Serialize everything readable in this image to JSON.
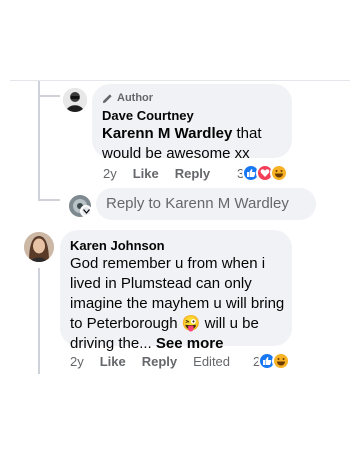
{
  "comments": [
    {
      "is_author": true,
      "author_badge": "Author",
      "name": "Dave Courtney",
      "mention": "Karenn M Wardley",
      "text_after_mention": " that would be awesome xx",
      "time": "2y",
      "like_label": "Like",
      "reply_label": "Reply",
      "reaction_count": "3",
      "reactions": [
        "like",
        "love",
        "haha"
      ]
    },
    {
      "name": "Karen Johnson",
      "text": "God remember u from when i lived in Plumstead can only imagine the mayhem u will bring to Peterborough",
      "emoji": "😜",
      "text_after_emoji": " will u be driving the... ",
      "see_more": "See more",
      "time": "2y",
      "like_label": "Like",
      "reply_label": "Reply",
      "edited_label": "Edited",
      "reaction_count": "2",
      "reactions": [
        "like",
        "haha"
      ]
    }
  ],
  "reply_input": {
    "placeholder": "Reply to Karenn M Wardley"
  },
  "colors": {
    "like": "#1877f2",
    "love": "#f33e58",
    "haha": "#f7b125",
    "bubble": "#f0f2f5",
    "meta": "#65676b"
  }
}
